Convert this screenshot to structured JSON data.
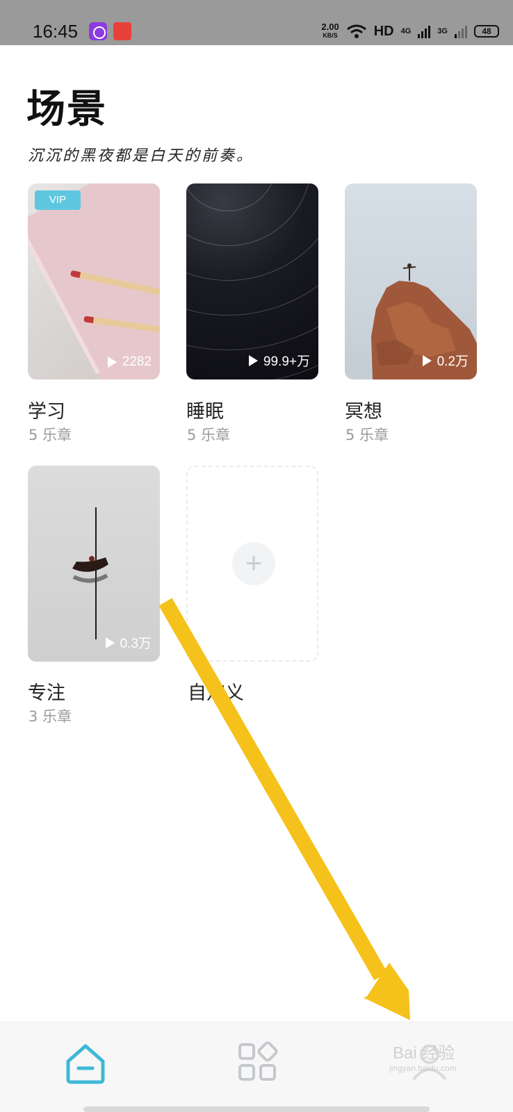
{
  "status_bar": {
    "time": "16:45",
    "net_speed_value": "2.00",
    "net_speed_unit": "KB/S",
    "hd_label": "HD",
    "net1": "4G",
    "net2": "3G",
    "battery": "48"
  },
  "header": {
    "title": "场景",
    "subtitle": "沉沉的黑夜都是白天的前奏。"
  },
  "scenes": [
    {
      "name": "学习",
      "chapters": "5 乐章",
      "plays": "2282",
      "badge": "VIP"
    },
    {
      "name": "睡眠",
      "chapters": "5 乐章",
      "plays": "99.9+万"
    },
    {
      "name": "冥想",
      "chapters": "5 乐章",
      "plays": "0.2万"
    },
    {
      "name": "专注",
      "chapters": "3 乐章",
      "plays": "0.3万"
    },
    {
      "name": "自定义",
      "add_symbol": "+"
    }
  ],
  "bottom_nav": {
    "items": [
      {
        "icon": "home-icon",
        "active": true
      },
      {
        "icon": "grid-icon",
        "active": false
      },
      {
        "icon": "profile-icon",
        "active": false
      }
    ],
    "active_color": "#3fb8d6",
    "inactive_color": "#c5c8cc"
  },
  "watermark": {
    "text": "Bai 经验",
    "sub": "jingyan.baidu.com"
  },
  "colors": {
    "accent": "#3fb8d6",
    "vip": "#5ec7e0",
    "arrow": "#f5c21b"
  }
}
